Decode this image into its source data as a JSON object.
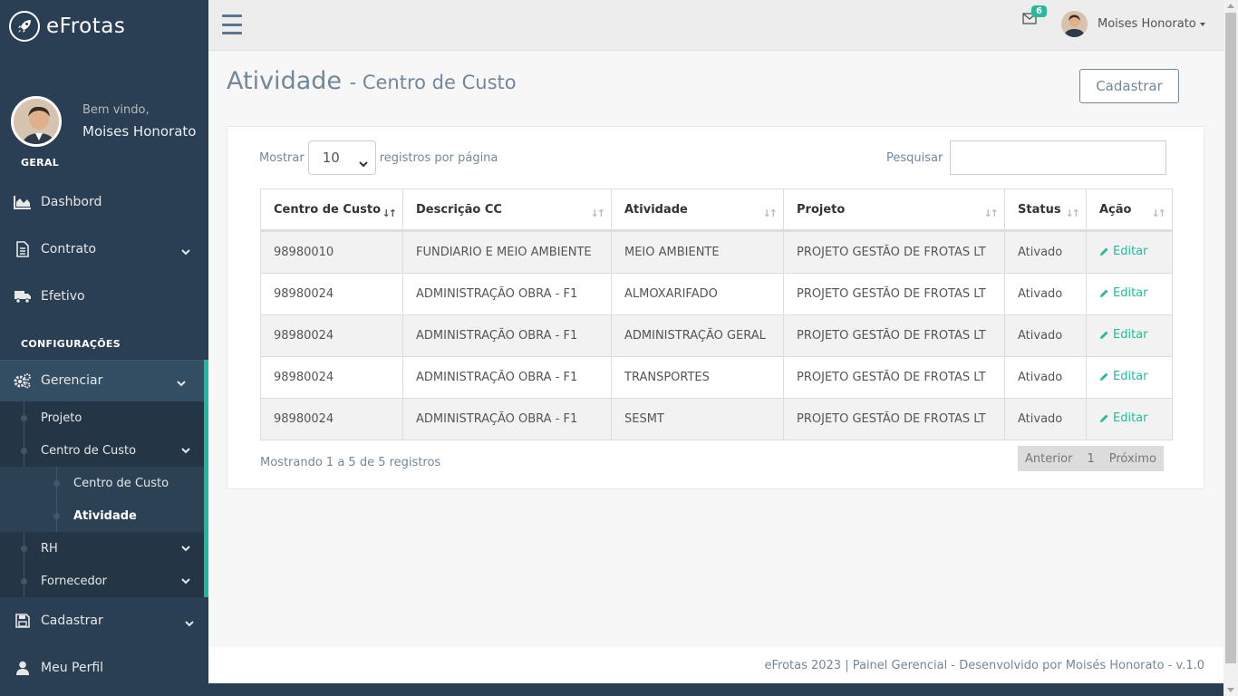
{
  "brand": {
    "name": "eFrotas"
  },
  "profile": {
    "welcome": "Bem vindo,",
    "name": "Moises Honorato"
  },
  "sidebar": {
    "section_general": "GERAL",
    "section_config": "CONFIGURAÇÕES",
    "items": [
      {
        "label": "Dashbord",
        "icon": "chart-area-icon"
      },
      {
        "label": "Contrato",
        "icon": "file-icon"
      },
      {
        "label": "Efetivo",
        "icon": "truck-icon"
      },
      {
        "label": "Gerenciar",
        "icon": "cogs-icon"
      },
      {
        "label": "Cadastrar",
        "icon": "save-icon"
      },
      {
        "label": "Meu Perfil",
        "icon": "user-icon"
      }
    ],
    "sub": {
      "projeto": "Projeto",
      "centro_de_custo": "Centro de Custo",
      "cc_child": "Centro de Custo",
      "atividade": "Atividade",
      "rh": "RH",
      "fornecedor": "Fornecedor"
    }
  },
  "topnav": {
    "mail_badge": "6",
    "user_name": "Moises Honorato"
  },
  "page": {
    "title": "Atividade",
    "subtitle": "- Centro de Custo",
    "button_cadastrar": "Cadastrar"
  },
  "table": {
    "show_label": "Mostrar",
    "page_size": "10",
    "per_page_label": "registros por página",
    "search_label": "Pesquisar",
    "search_value": "",
    "columns": [
      "Centro de Custo",
      "Descrição CC",
      "Atividade",
      "Projeto",
      "Status",
      "Ação"
    ],
    "rows": [
      [
        "98980010",
        "FUNDIARIO E MEIO AMBIENTE",
        "MEIO AMBIENTE",
        "PROJETO GESTÃO DE FROTAS LT",
        "Ativado",
        "Editar"
      ],
      [
        "98980024",
        "ADMINISTRAÇÃO OBRA - F1",
        "ALMOXARIFADO",
        "PROJETO GESTÃO DE FROTAS LT",
        "Ativado",
        "Editar"
      ],
      [
        "98980024",
        "ADMINISTRAÇÃO OBRA - F1",
        "ADMINISTRAÇÃO GERAL",
        "PROJETO GESTÃO DE FROTAS LT",
        "Ativado",
        "Editar"
      ],
      [
        "98980024",
        "ADMINISTRAÇÃO OBRA - F1",
        "TRANSPORTES",
        "PROJETO GESTÃO DE FROTAS LT",
        "Ativado",
        "Editar"
      ],
      [
        "98980024",
        "ADMINISTRAÇÃO OBRA - F1",
        "SESMT",
        "PROJETO GESTÃO DE FROTAS LT",
        "Ativado",
        "Editar"
      ]
    ],
    "info": "Mostrando 1 a 5 de 5 registros",
    "pager": {
      "prev": "Anterior",
      "page": "1",
      "next": "Próximo"
    }
  },
  "footer": {
    "text": "eFrotas 2023 | Painel Gerencial - Desenvolvido por Moisés Honorato - v.1.0"
  },
  "colors": {
    "sidebar": "#2a3f54",
    "accent": "#1abb9c",
    "edit": "#26b99a"
  }
}
